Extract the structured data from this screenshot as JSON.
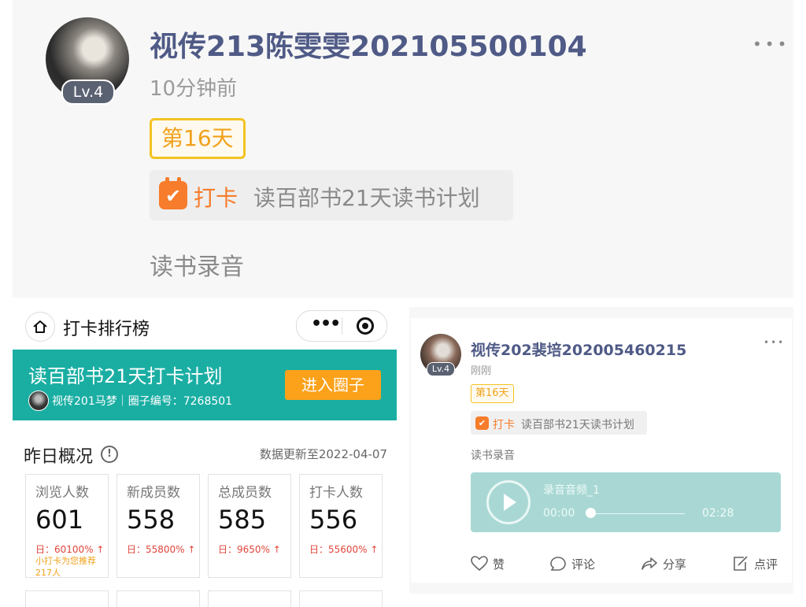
{
  "top_post": {
    "username": "视传213陈雯雯202105500104",
    "level": "Lv.4",
    "time": "10分钟前",
    "more": "•••",
    "day_badge": "第16天",
    "checkin_icon_text": "✔",
    "checkin_label": "打卡",
    "checkin_plan": "读百部书21天读书计划",
    "content": "读书录音"
  },
  "ranking_panel": {
    "nav_title": "打卡排行榜",
    "capsule_dots": "•••",
    "banner": {
      "title": "读百部书21天打卡计划",
      "meta": "视传201马梦｜圈子编号：7268501",
      "join_button": "进入圈子",
      "bg_color": "#1aaea3",
      "button_color": "#fba11a"
    },
    "overview_title": "昨日概况",
    "info_icon": "!",
    "update_text": "数据更新至2022-04-07",
    "stats": [
      {
        "label": "浏览人数",
        "value": "601",
        "change": "日：60100% ↑",
        "note": "小打卡为您推荐217人"
      },
      {
        "label": "新成员数",
        "value": "558",
        "change": "日：55800% ↑",
        "note": ""
      },
      {
        "label": "总成员数",
        "value": "585",
        "change": "日：9650% ↑",
        "note": ""
      },
      {
        "label": "打卡人数",
        "value": "556",
        "change": "日：55600% ↑",
        "note": ""
      }
    ]
  },
  "second_post": {
    "username": "视传202裴培202005460215",
    "level": "Lv.4",
    "time": "刚刚",
    "more": "•••",
    "day_badge": "第16天",
    "checkin_icon_text": "✔",
    "checkin_label": "打卡",
    "checkin_plan": "读百部书21天读书计划",
    "content": "读书录音",
    "audio": {
      "title": "录音音频_1",
      "current_time": "00:00",
      "duration": "02:28",
      "progress": 0,
      "bg_color": "#a9d8d4"
    },
    "actions": {
      "like": "赞",
      "comment": "评论",
      "share": "分享",
      "review": "点评"
    }
  },
  "colors": {
    "username": "#4f5a86",
    "accent_orange": "#f77c2b",
    "badge_gold": "#f3c321",
    "increase_red": "#e0463a"
  }
}
